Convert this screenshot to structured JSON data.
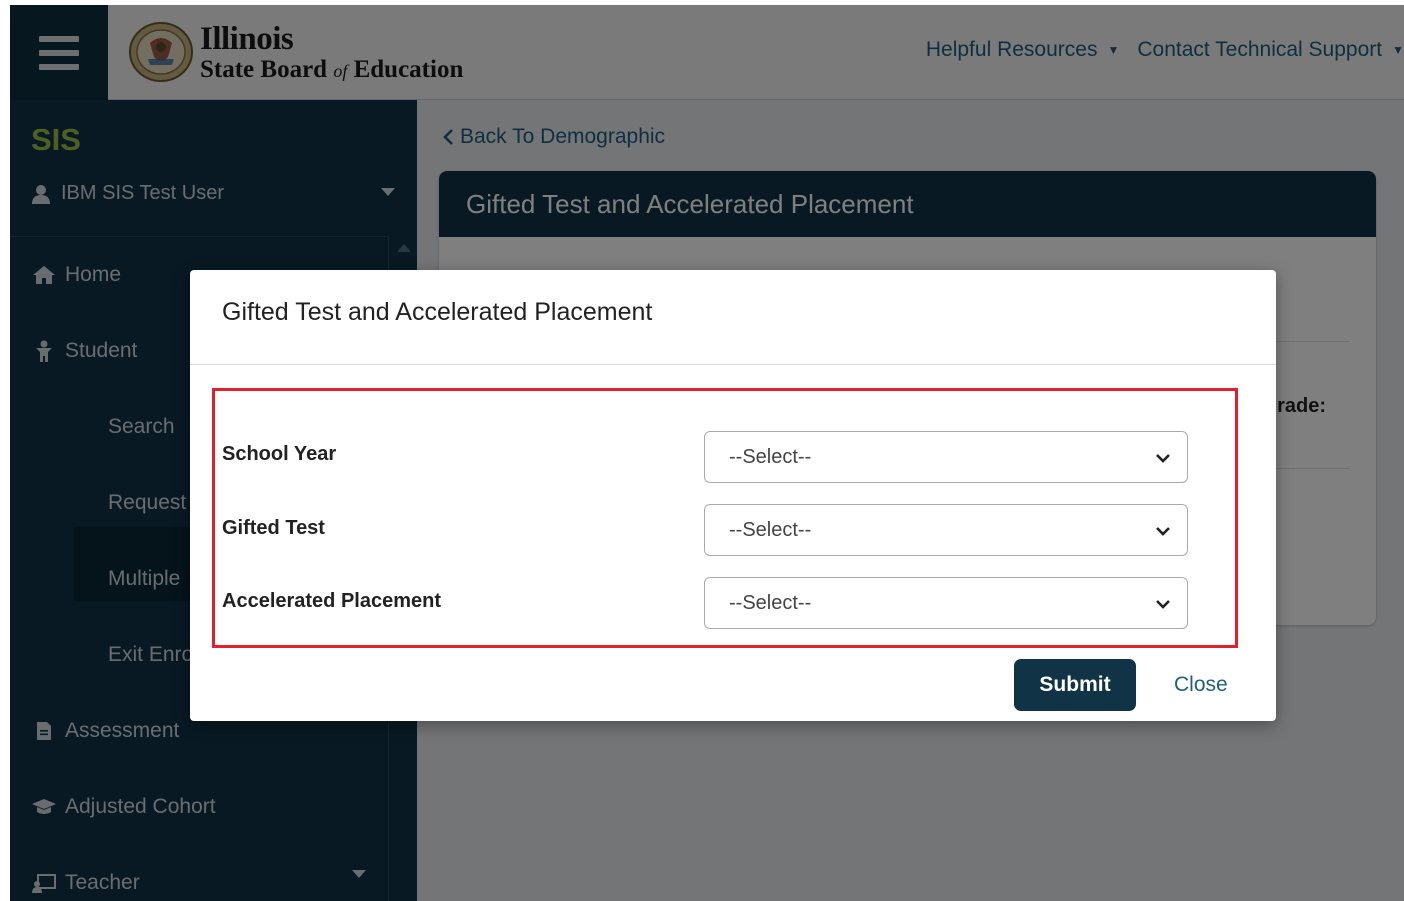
{
  "header": {
    "logo_line1": "Illinois",
    "logo_line2_a": "State Board",
    "logo_line2_of": "of",
    "logo_line2_b": "Education",
    "links": [
      {
        "label": "Helpful Resources",
        "icon": "caret-down-icon"
      },
      {
        "label": "Contact Technical Support",
        "icon": "caret-down-icon"
      }
    ]
  },
  "sidebar": {
    "app_name": "SIS",
    "user": "IBM SIS Test User",
    "items": [
      {
        "label": "Home",
        "icon": "home-icon"
      },
      {
        "label": "Student",
        "icon": "student-icon"
      },
      {
        "label": "Assessment",
        "icon": "document-icon"
      },
      {
        "label": "Adjusted Cohort",
        "icon": "graduation-cap-icon"
      },
      {
        "label": "Teacher",
        "icon": "teacher-icon"
      }
    ],
    "student_subitems": [
      "Search",
      "Request",
      "Multiple",
      "Exit Enro"
    ]
  },
  "main": {
    "back_link": "Back To Demographic",
    "panel_title": "Gifted Test and Accelerated Placement",
    "partial_text": "rade:"
  },
  "modal": {
    "title": "Gifted Test and Accelerated Placement",
    "fields": [
      {
        "label": "School Year",
        "value": "--Select--"
      },
      {
        "label": "Gifted Test",
        "value": "--Select--"
      },
      {
        "label": "Accelerated Placement",
        "value": "--Select--"
      }
    ],
    "submit_label": "Submit",
    "close_label": "Close"
  },
  "colors": {
    "navy": "#103346",
    "accent_green": "#9bc045",
    "link_blue": "#1f5f82",
    "highlight_red": "#e0202c"
  }
}
